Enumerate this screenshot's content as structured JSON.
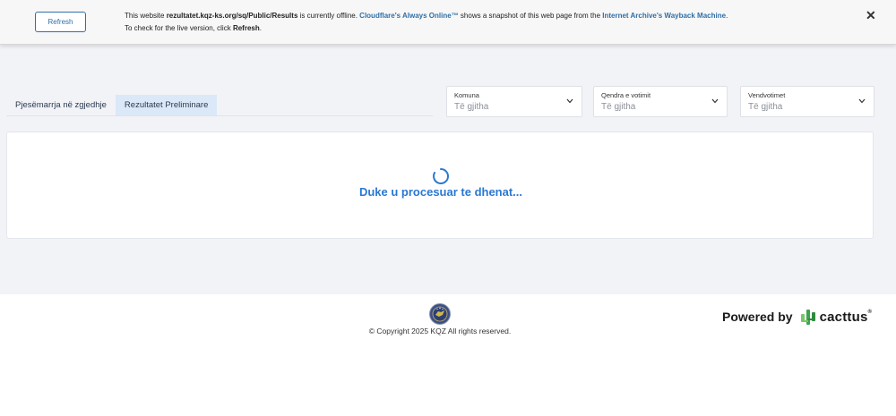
{
  "cloudflare": {
    "refresh_label": "Refresh",
    "msg_prefix": "This website ",
    "msg_url": "rezultatet.kqz-ks.org/sq/Public/Results",
    "msg_mid1": " is currently offline. ",
    "msg_link1": "Cloudflare's Always Online™",
    "msg_mid2": " shows a snapshot of this web page from the ",
    "msg_link2": "Internet Archive's Wayback Machine",
    "msg_mid3": ". To check for the live version, click ",
    "msg_refresh": "Refresh",
    "msg_end": ".",
    "close_glyph": "✕"
  },
  "tabs": [
    {
      "label": "Pjesëmarrja në zgjedhje",
      "active": false
    },
    {
      "label": "Rezultatet Preliminare",
      "active": true
    }
  ],
  "filters": [
    {
      "label": "Komuna",
      "value": "Të gjitha"
    },
    {
      "label": "Qendra e votimit",
      "value": "Të gjitha"
    },
    {
      "label": "Vendvotimet",
      "value": "Të gjitha"
    }
  ],
  "content": {
    "loading_text": "Duke u procesuar te dhenat..."
  },
  "footer": {
    "copyright": "© Copyright 2025 KQZ All rights reserved.",
    "powered_text": "Powered by",
    "brand": "cacttus",
    "brand_tm": "®"
  },
  "colors": {
    "accent": "#2a78d3",
    "link": "#2f6fa7",
    "brand_green": "#5cb85c"
  }
}
